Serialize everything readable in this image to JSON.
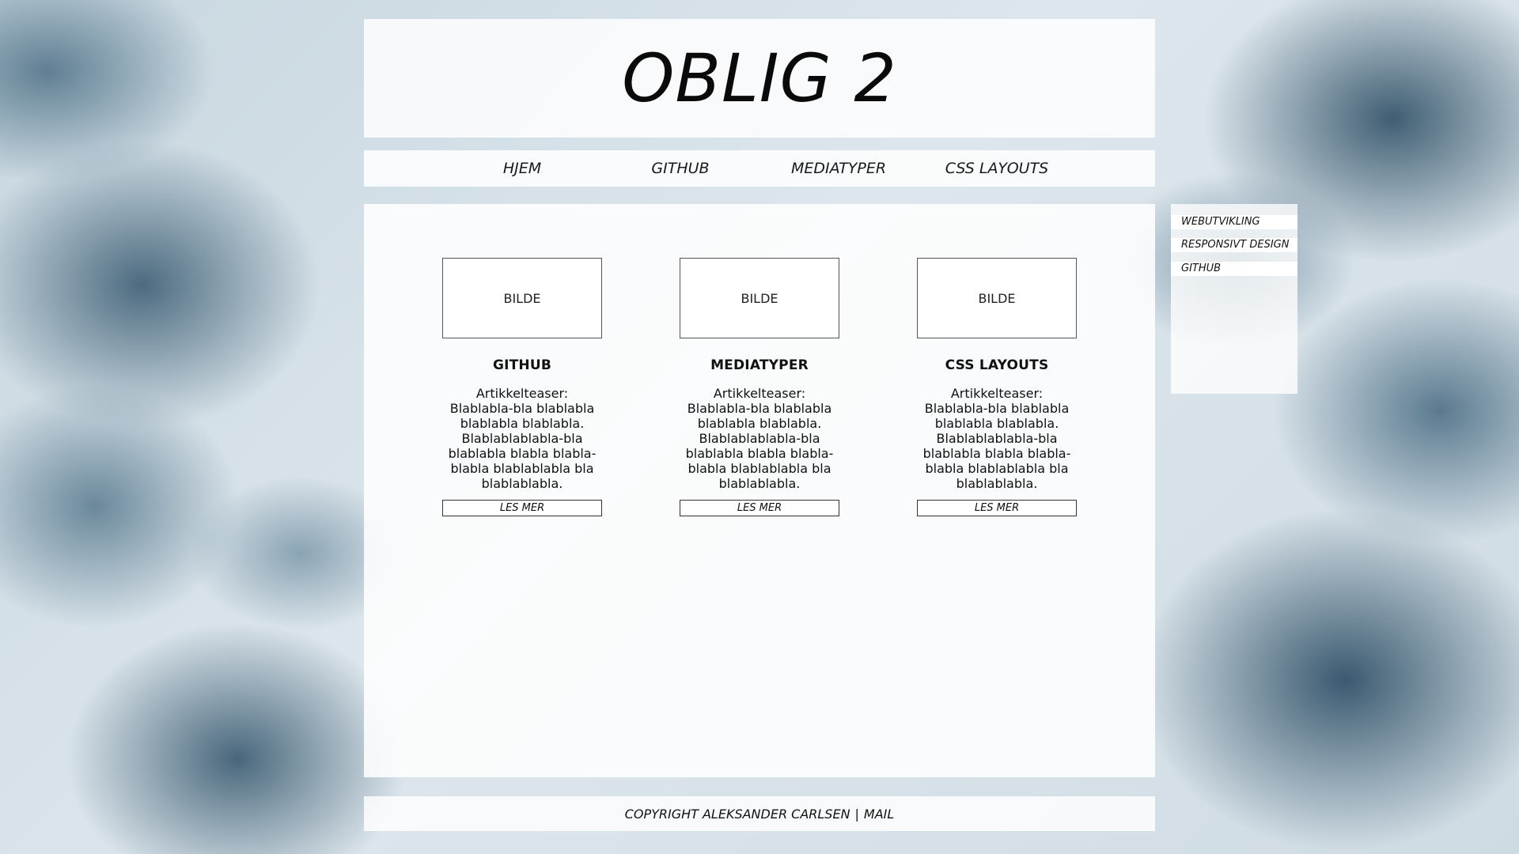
{
  "header": {
    "title": "OBLIG 2"
  },
  "nav": {
    "items": [
      {
        "label": "HJEM"
      },
      {
        "label": "GITHUB"
      },
      {
        "label": "MEDIATYPER"
      },
      {
        "label": "CSS LAYOUTS"
      }
    ]
  },
  "main": {
    "cards": [
      {
        "image_label": "BILDE",
        "title": "GITHUB",
        "teaser": "Artikkelteaser: Blablabla-bla blablabla blablabla blablabla. Blablablablabla-bla blablabla blabla blabla-blabla blablablabla bla blablablabla.",
        "button": "LES MER"
      },
      {
        "image_label": "BILDE",
        "title": "MEDIATYPER",
        "teaser": "Artikkelteaser: Blablabla-bla blablabla blablabla blablabla. Blablablablabla-bla blablabla blabla blabla-blabla blablablabla bla blablablabla.",
        "button": "LES MER"
      },
      {
        "image_label": "BILDE",
        "title": "CSS LAYOUTS",
        "teaser": "Artikkelteaser: Blablabla-bla blablabla blablabla blablabla. Blablablablabla-bla blablabla blabla blabla-blabla blablablabla bla blablablabla.",
        "button": "LES MER"
      }
    ]
  },
  "aside": {
    "links": [
      {
        "label": "WEBUTVIKLING"
      },
      {
        "label": "RESPONSIVT DESIGN"
      },
      {
        "label": "GITHUB"
      }
    ]
  },
  "footer": {
    "copyright": "COPYRIGHT ALEKSANDER CARLSEN",
    "separator": "|",
    "mail": "MAIL"
  }
}
